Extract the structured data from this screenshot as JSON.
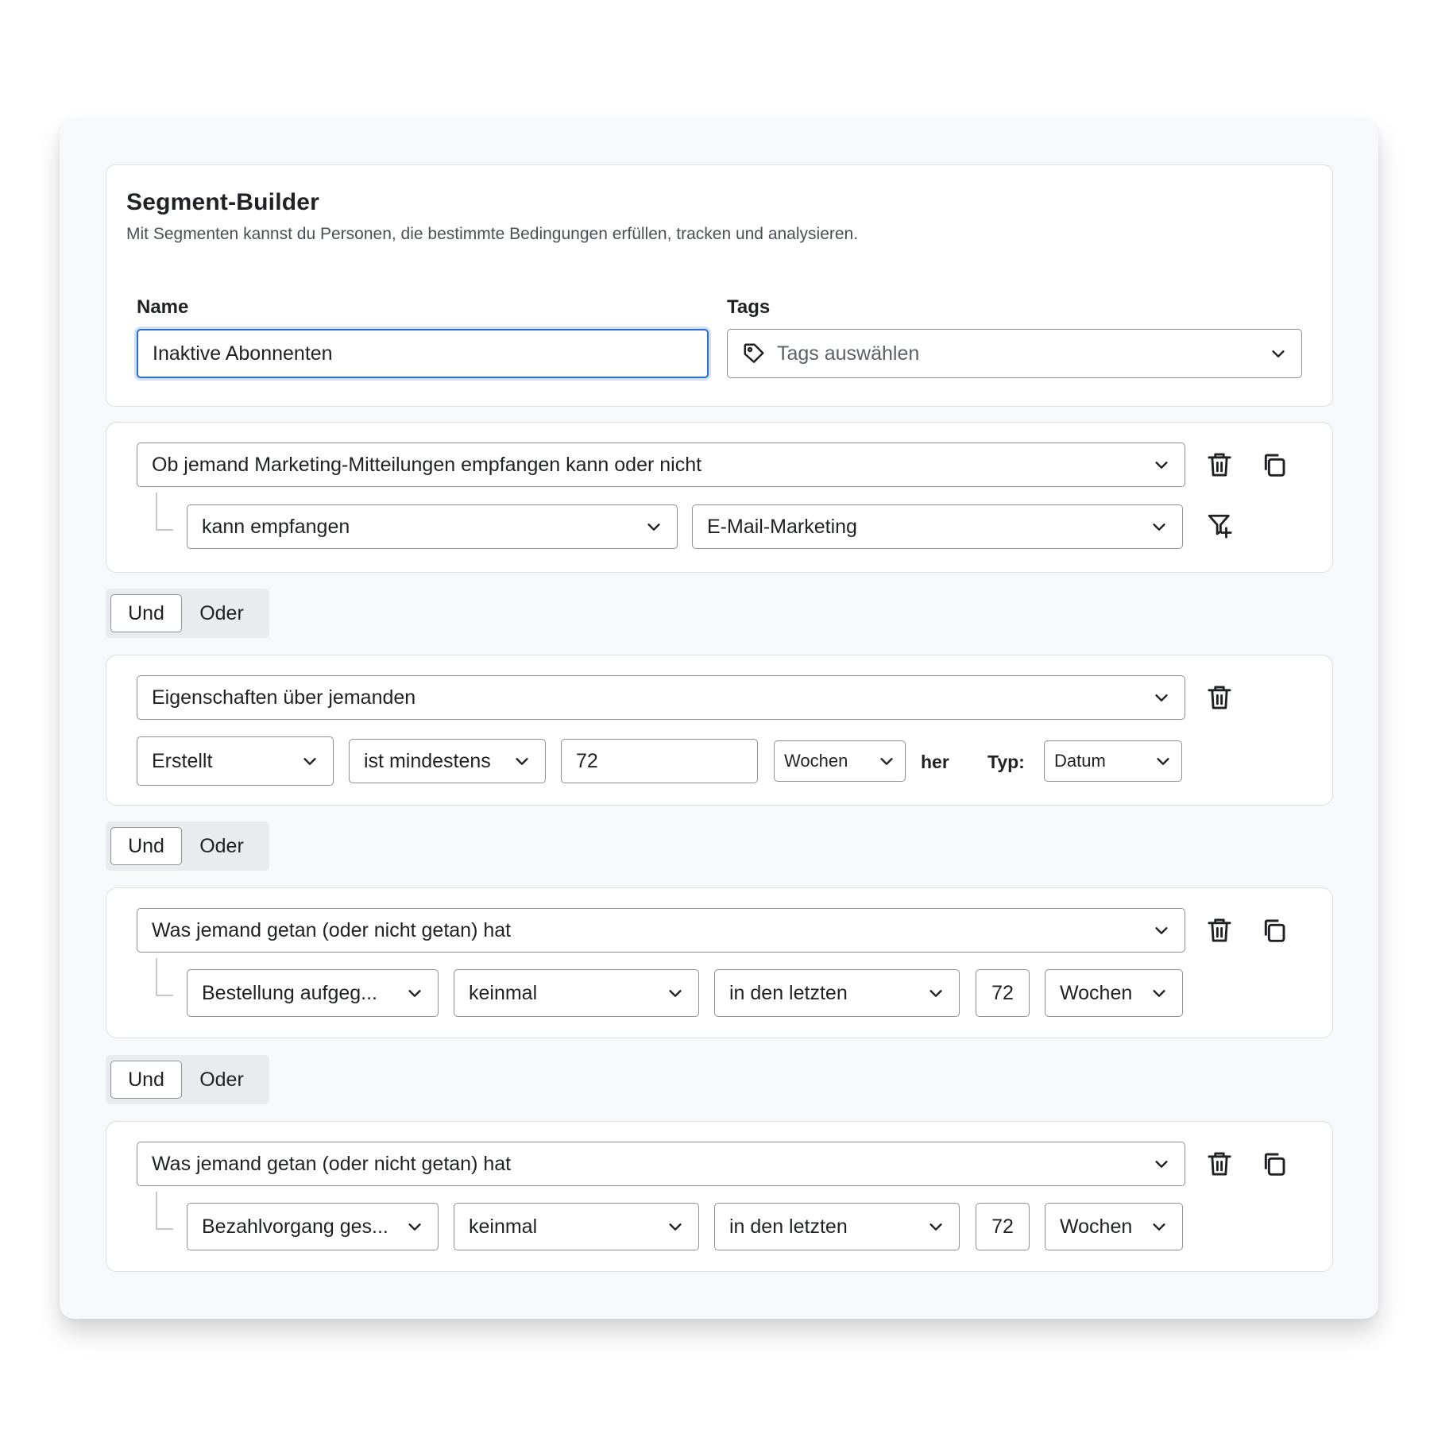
{
  "header": {
    "title": "Segment-Builder",
    "subtitle": "Mit Segmenten kannst du Personen, die bestimmte Bedingungen erfüllen, tracken und analysieren.",
    "name_label": "Name",
    "name_value": "Inaktive Abonnenten",
    "tags_label": "Tags",
    "tags_placeholder": "Tags auswählen"
  },
  "logic": {
    "and_label": "Und",
    "or_label": "Oder",
    "selected": "Und"
  },
  "conditions": [
    {
      "type": "Ob jemand Marketing-Mitteilungen empfangen kann oder nicht",
      "status": "kann empfangen",
      "channel": "E-Mail-Marketing"
    },
    {
      "type": "Eigenschaften über jemanden",
      "property": "Erstellt",
      "operator": "ist mindestens",
      "amount": "72",
      "unit": "Wochen",
      "suffix": "her",
      "type_label": "Typ:",
      "value_type": "Datum"
    },
    {
      "type": "Was jemand getan (oder nicht getan) hat",
      "event": "Bestellung aufgeg...",
      "frequency": "keinmal",
      "timeframe": "in den letzten",
      "amount": "72",
      "unit": "Wochen"
    },
    {
      "type": "Was jemand getan (oder nicht getan) hat",
      "event": "Bezahlvorgang ges...",
      "frequency": "keinmal",
      "timeframe": "in den letzten",
      "amount": "72",
      "unit": "Wochen"
    }
  ],
  "icons": {
    "delete": "trash-icon",
    "duplicate": "copy-icon",
    "add_filter": "filter-plus-icon",
    "dropdown": "chevron-down-icon",
    "tag": "tag-icon"
  },
  "colors": {
    "focus_border": "#2c6ecb",
    "panel_bg": "#f7f8f9",
    "text": "#1f2124"
  }
}
